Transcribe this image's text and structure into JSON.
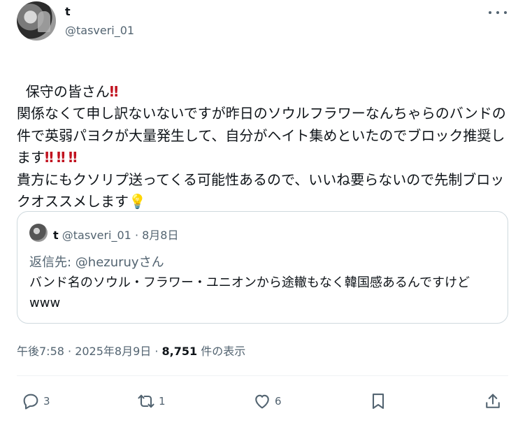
{
  "author": {
    "display_name": "t",
    "handle": "@tasveri_01"
  },
  "tweet": {
    "segments": [
      {
        "text": "保守の皆さん"
      },
      {
        "text": "‼",
        "type": "bang"
      },
      {
        "text": "\n関係なくて申し訳ないないですが昨日のソウルフラワーなんちゃらのバンドの件で英弱パヨクが大量発生して、自分がヘイト集めといたのでブロック推奨します"
      },
      {
        "text": "‼",
        "type": "bang"
      },
      {
        "text": " "
      },
      {
        "text": "‼",
        "type": "bang"
      },
      {
        "text": " "
      },
      {
        "text": "‼",
        "type": "bang"
      },
      {
        "text": "\n貴方にもクソリプ送ってくる可能性あるので、いいね要らないので先制ブロックオススメします"
      },
      {
        "text": "💡",
        "type": "emoji"
      }
    ]
  },
  "quote": {
    "display_name": "t",
    "meta": "@tasveri_01 · 8月8日",
    "reply_to": "返信先: @hezuruyさん",
    "text": "バンド名のソウル・フラワー・ユニオンから途轍もなく韓国感あるんですけどwww"
  },
  "meta": {
    "time_date": "午後7:58 · 2025年8月9日 · ",
    "views_count": "8,751",
    "views_label": " 件の表示"
  },
  "actions": {
    "replies": "3",
    "retweets": "1",
    "likes": "6"
  },
  "icons": [
    "more-icon",
    "reply-icon",
    "retweet-icon",
    "like-icon",
    "bookmark-icon",
    "share-icon"
  ],
  "colors": {
    "text": "#0f1419",
    "secondary": "#536471",
    "border": "#cfd9de",
    "bang": "#c1121f"
  }
}
